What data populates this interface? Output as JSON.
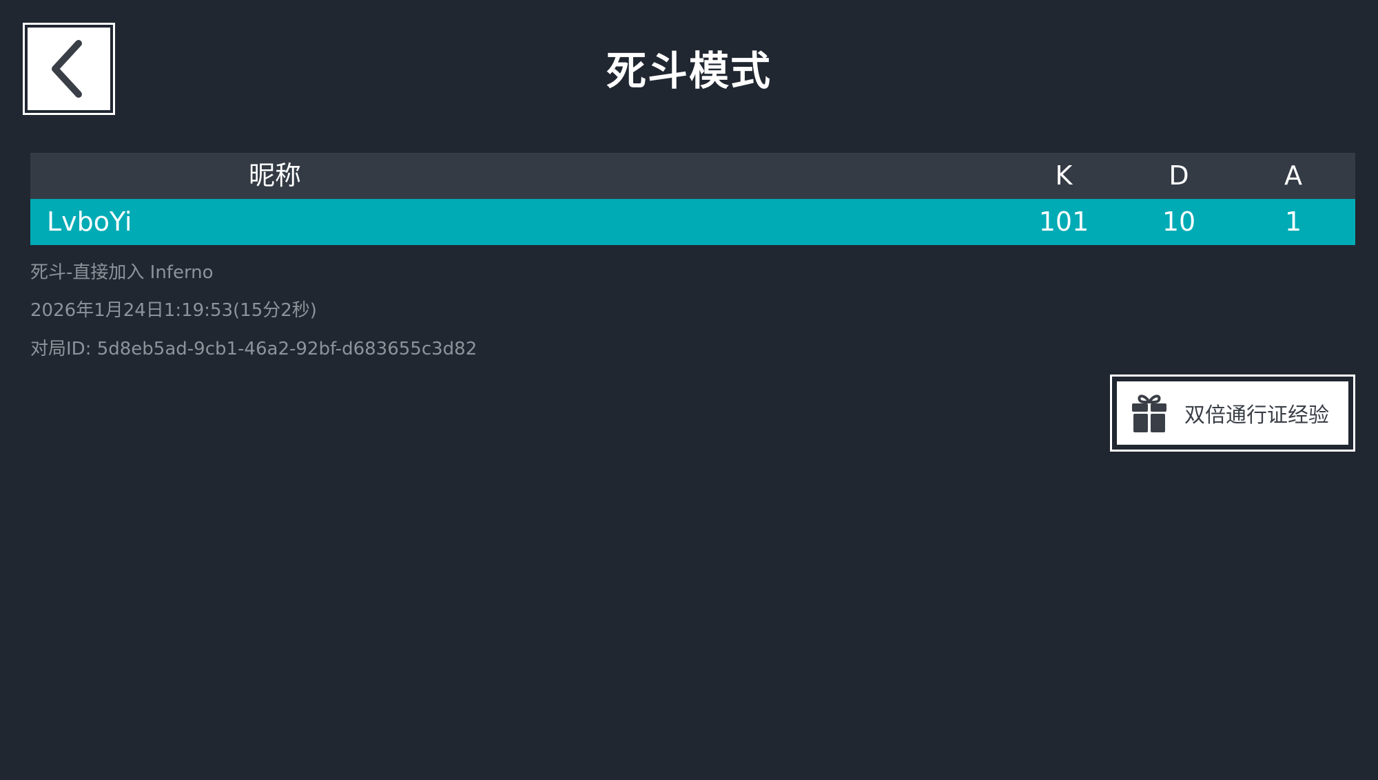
{
  "header": {
    "title": "死斗模式",
    "back_icon": "chevron-left-icon"
  },
  "scoreboard": {
    "columns": {
      "name": "昵称",
      "k": "K",
      "d": "D",
      "a": "A"
    },
    "rows": [
      {
        "name": "LvboYi",
        "k": "101",
        "d": "10",
        "a": "1"
      }
    ],
    "colors": {
      "header_bg": "#343b45",
      "highlight_row_bg": "#00abb5"
    }
  },
  "match_info": {
    "mode_map": "死斗-直接加入 Inferno",
    "datetime": "2026年1月24日1:19:53(15分2秒)",
    "match_id": "对局ID: 5d8eb5ad-9cb1-46a2-92bf-d683655c3d82"
  },
  "pass_button": {
    "label": "双倍通行证经验",
    "icon": "gift-icon"
  },
  "colors": {
    "background": "#202731",
    "text_primary": "#ffffff",
    "text_secondary": "#8e939b"
  }
}
